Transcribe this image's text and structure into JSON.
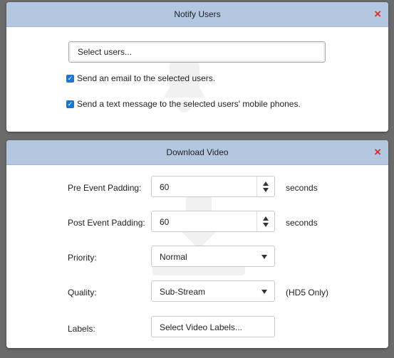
{
  "notify": {
    "title": "Notify Users",
    "close_icon": "×",
    "select_users_placeholder": "Select users...",
    "email_option": "Send an email to the selected users.",
    "email_checked": true,
    "sms_option": "Send a text message to the selected users' mobile phones.",
    "sms_checked": true,
    "watermark_icon": "bell-icon"
  },
  "download": {
    "title": "Download Video",
    "close_icon": "×",
    "watermark_icon": "download-arrow-icon",
    "pre_label": "Pre Event Padding:",
    "pre_value": "60",
    "pre_unit": "seconds",
    "post_label": "Post Event Padding:",
    "post_value": "60",
    "post_unit": "seconds",
    "priority_label": "Priority:",
    "priority_value": "Normal",
    "quality_label": "Quality:",
    "quality_value": "Sub-Stream",
    "quality_note": "(HD5 Only)",
    "labels_label": "Labels:",
    "labels_placeholder": "Select Video Labels..."
  },
  "colors": {
    "titlebar": "#b3c7e0",
    "close": "#d32f2f",
    "checkbox": "#1976d2",
    "backdrop": "#6b6b6b"
  }
}
